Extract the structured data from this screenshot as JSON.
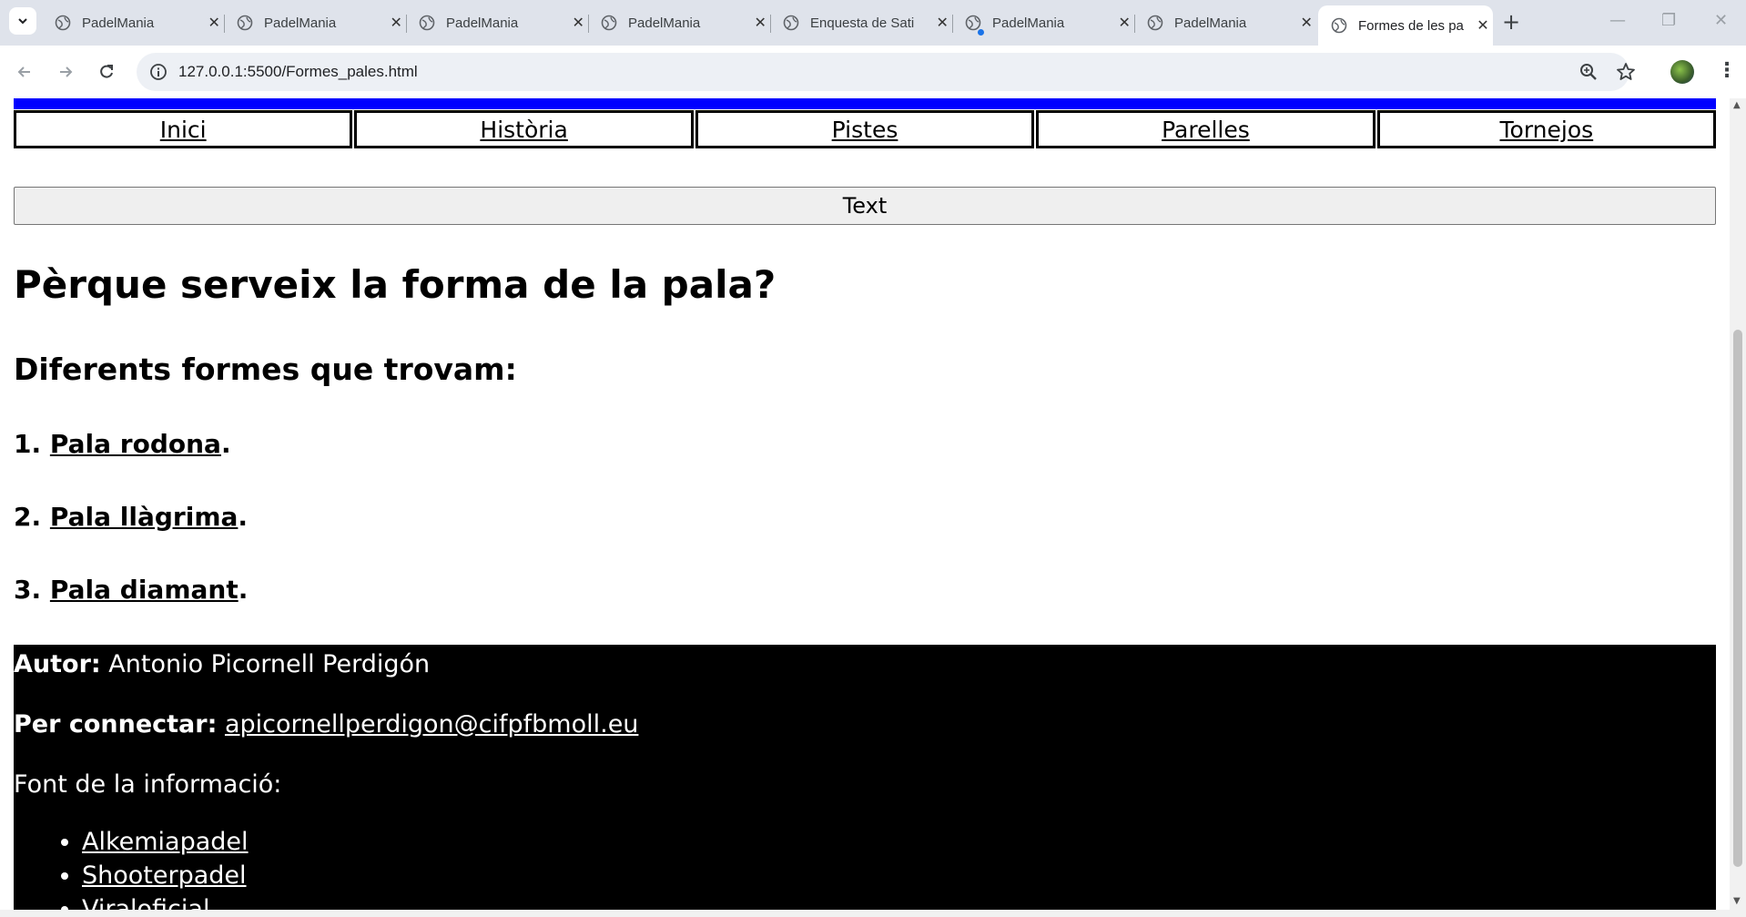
{
  "browser": {
    "tabs": [
      {
        "title": "PadelMania",
        "active": false
      },
      {
        "title": "PadelMania",
        "active": false
      },
      {
        "title": "PadelMania",
        "active": false
      },
      {
        "title": "PadelMania",
        "active": false
      },
      {
        "title": "Enquesta de Sati",
        "active": false
      },
      {
        "title": "PadelMania",
        "active": false
      },
      {
        "title": "PadelMania",
        "active": false
      },
      {
        "title": "Formes de les pa",
        "active": true
      }
    ],
    "url": "127.0.0.1:5500/Formes_pales.html"
  },
  "page": {
    "menu": [
      "Inici",
      "Història",
      "Pistes",
      "Parelles",
      "Tornejos"
    ],
    "text_button": "Text",
    "heading": "Pèrque serveix la forma de la pala?",
    "subheading": "Diferents formes que trovam:",
    "items": [
      {
        "num": "1.",
        "label": "Pala rodona"
      },
      {
        "num": "2.",
        "label": "Pala llàgrima"
      },
      {
        "num": "3.",
        "label": "Pala diamant"
      }
    ],
    "footer": {
      "author_label": "Autor:",
      "author_name": "Antonio Picornell Perdigón",
      "contact_label": "Per connectar:",
      "contact_email": "apicornellperdigon@cifpfbmoll.eu",
      "source_label": "Font de la informació:",
      "sources": [
        "Alkemiapadel",
        "Shooterpadel",
        "Viraloficial"
      ]
    }
  }
}
